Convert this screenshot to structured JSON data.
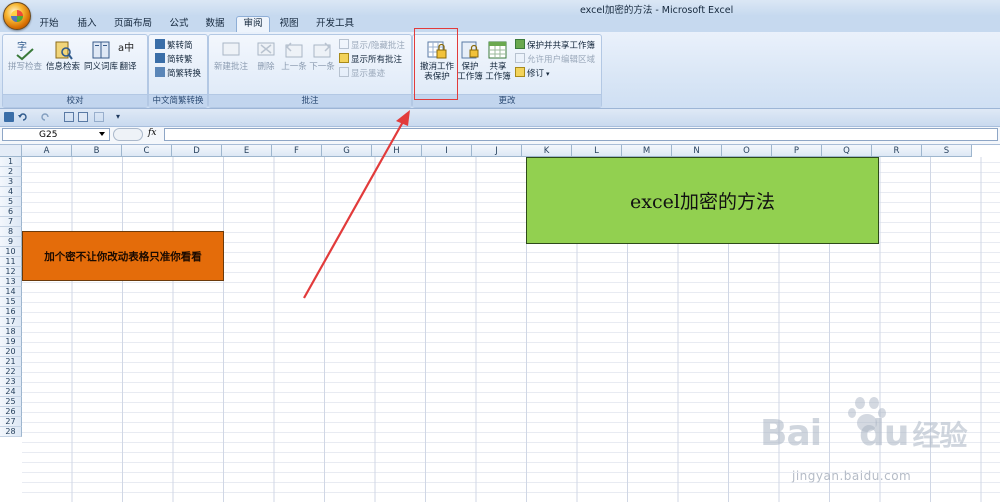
{
  "window": {
    "title": "excel加密的方法 - Microsoft Excel"
  },
  "tabs": [
    {
      "label": "开始"
    },
    {
      "label": "插入"
    },
    {
      "label": "页面布局"
    },
    {
      "label": "公式"
    },
    {
      "label": "数据"
    },
    {
      "label": "审阅",
      "active": true
    },
    {
      "label": "视图"
    },
    {
      "label": "开发工具"
    }
  ],
  "ribbon": {
    "proofing": {
      "label": "校对",
      "spell": "拼写检查",
      "research": "信息检索",
      "thesaurus": "同义词库",
      "translate": "翻译",
      "spell_icon_text": "字",
      "translate_icon_text": "a中"
    },
    "chinese": {
      "label": "中文简繁转换",
      "to_simplified": "繁转简",
      "to_traditional": "简转繁",
      "convert": "简繁转换"
    },
    "comments": {
      "label": "批注",
      "new": "新建批注",
      "delete": "删除",
      "prev": "上一条",
      "next": "下一条",
      "show_hide": "显示/隐藏批注",
      "show_all": "显示所有批注",
      "show_ink": "显示墨迹"
    },
    "changes": {
      "label": "更改",
      "unprotect_line1": "撤消工作",
      "unprotect_line2": "表保护",
      "protect_wb_line1": "保护",
      "protect_wb_line2": "工作簿",
      "share_line1": "共享",
      "share_line2": "工作簿",
      "protect_share": "保护并共享工作簿",
      "allow_edit": "允许用户编辑区域",
      "track": "修订"
    }
  },
  "formula_bar": {
    "name_box": "G25",
    "fx": "fx",
    "formula": ""
  },
  "grid": {
    "columns": [
      "A",
      "B",
      "C",
      "D",
      "E",
      "F",
      "G",
      "H",
      "I",
      "J",
      "K",
      "L",
      "M",
      "N",
      "O",
      "P",
      "Q",
      "R",
      "S"
    ],
    "rows": [
      "1",
      "2",
      "3",
      "4",
      "5",
      "6",
      "7",
      "8",
      "9",
      "10",
      "11",
      "12",
      "13",
      "14",
      "15",
      "16",
      "17",
      "18",
      "19",
      "20",
      "21",
      "22",
      "23",
      "24",
      "25",
      "26",
      "27",
      "28"
    ]
  },
  "cells": {
    "orange_text": "加个密不让你改动表格只准你看看",
    "green_text": "excel加密的方法"
  },
  "colors": {
    "orange": "#e46c0a",
    "green": "#92d050",
    "arrow": "#e23b3b",
    "highlight": "#e23b3b"
  },
  "watermark": {
    "brand": "Bai",
    "brand_suffix": "du",
    "brand_cn": "经验",
    "url": "jingyan.baidu.com"
  }
}
